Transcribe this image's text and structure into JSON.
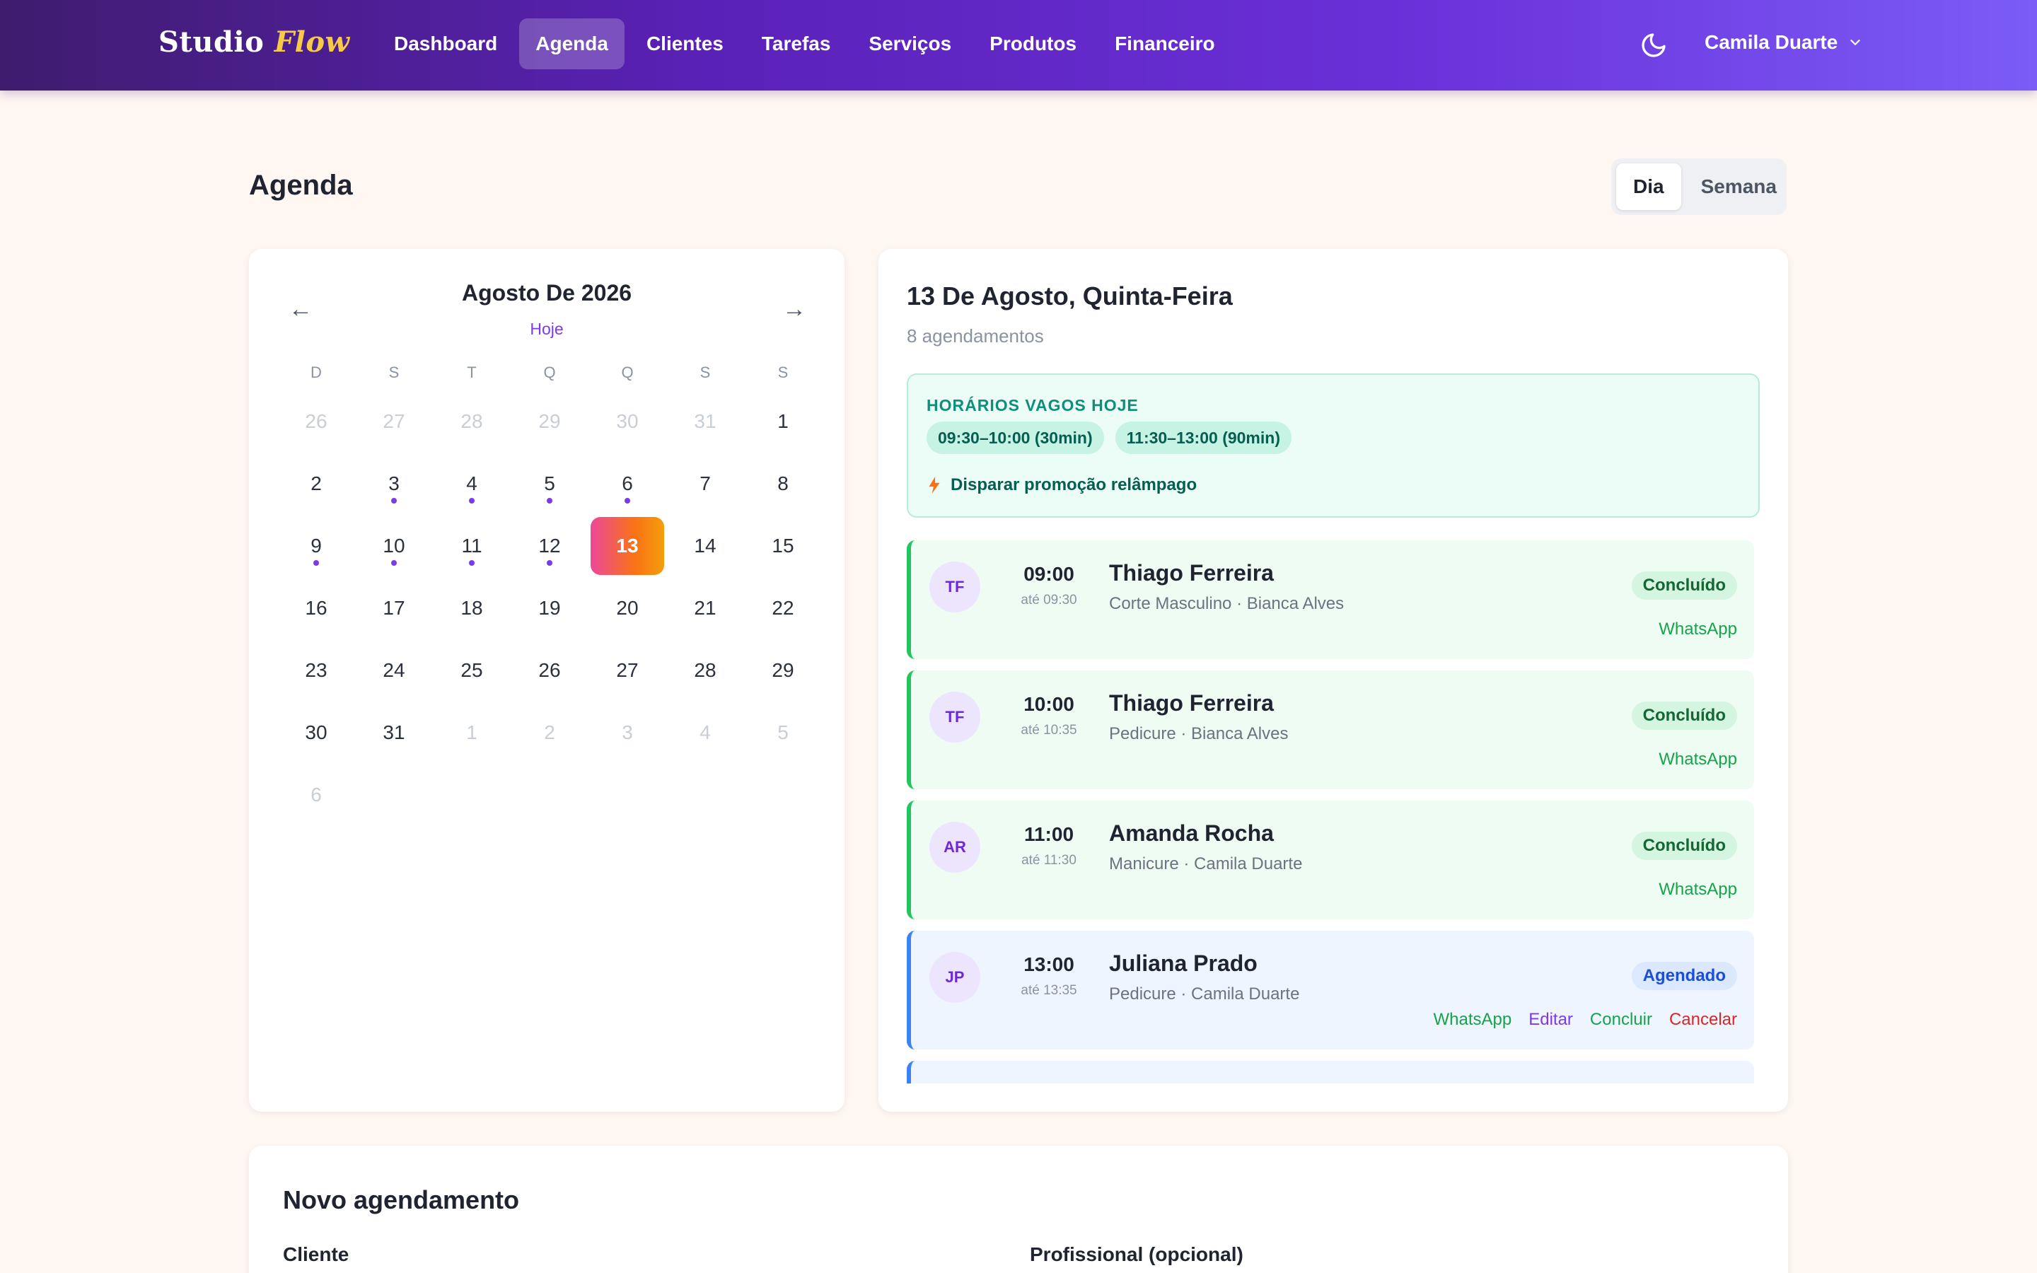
{
  "header": {
    "brand_main": "Studio",
    "brand_accent": "Flow",
    "nav": [
      "Dashboard",
      "Agenda",
      "Clientes",
      "Tarefas",
      "Serviços",
      "Produtos",
      "Financeiro"
    ],
    "active_nav": "Agenda",
    "user_name": "Camila Duarte",
    "theme_icon": "moon-icon"
  },
  "page": {
    "title": "Agenda",
    "view_day": "Dia",
    "view_week": "Semana",
    "active_view": "Dia"
  },
  "calendar": {
    "month_label": "Agosto De 2026",
    "today_label": "Hoje",
    "prev_arrow": "←",
    "next_arrow": "→",
    "weekdays": [
      "D",
      "S",
      "T",
      "Q",
      "Q",
      "S",
      "S"
    ],
    "days": [
      {
        "n": "26",
        "muted": true
      },
      {
        "n": "27",
        "muted": true
      },
      {
        "n": "28",
        "muted": true
      },
      {
        "n": "29",
        "muted": true
      },
      {
        "n": "30",
        "muted": true
      },
      {
        "n": "31",
        "muted": true
      },
      {
        "n": "1"
      },
      {
        "n": "2"
      },
      {
        "n": "3",
        "dot": true
      },
      {
        "n": "4",
        "dot": true
      },
      {
        "n": "5",
        "dot": true
      },
      {
        "n": "6",
        "dot": true
      },
      {
        "n": "7"
      },
      {
        "n": "8"
      },
      {
        "n": "9",
        "dot": true
      },
      {
        "n": "10",
        "dot": true
      },
      {
        "n": "11",
        "dot": true
      },
      {
        "n": "12",
        "dot": true
      },
      {
        "n": "13",
        "selected": true
      },
      {
        "n": "14"
      },
      {
        "n": "15"
      },
      {
        "n": "16"
      },
      {
        "n": "17"
      },
      {
        "n": "18"
      },
      {
        "n": "19"
      },
      {
        "n": "20"
      },
      {
        "n": "21"
      },
      {
        "n": "22"
      },
      {
        "n": "23"
      },
      {
        "n": "24"
      },
      {
        "n": "25"
      },
      {
        "n": "26"
      },
      {
        "n": "27"
      },
      {
        "n": "28"
      },
      {
        "n": "29"
      },
      {
        "n": "30"
      },
      {
        "n": "31"
      },
      {
        "n": "1",
        "muted": true
      },
      {
        "n": "2",
        "muted": true
      },
      {
        "n": "3",
        "muted": true
      },
      {
        "n": "4",
        "muted": true
      },
      {
        "n": "5",
        "muted": true
      },
      {
        "n": "6",
        "muted": true
      }
    ]
  },
  "day_panel": {
    "date_label": "13 De Agosto, Quinta-Feira",
    "count_label": "8 agendamentos",
    "free_title": "HORÁRIOS VAGOS HOJE",
    "free_slots": [
      "09:30–10:00 (30min)",
      "11:30–13:00 (90min)"
    ],
    "promo_label": "Disparar promoção relâmpago",
    "appointments": [
      {
        "initials": "TF",
        "start": "09:00",
        "end": "até 09:30",
        "client": "Thiago Ferreira",
        "service": "Corte Masculino · Bianca Alves",
        "status": "Concluído",
        "state": "done",
        "actions": [
          "WhatsApp"
        ]
      },
      {
        "initials": "TF",
        "start": "10:00",
        "end": "até 10:35",
        "client": "Thiago Ferreira",
        "service": "Pedicure · Bianca Alves",
        "status": "Concluído",
        "state": "done",
        "actions": [
          "WhatsApp"
        ]
      },
      {
        "initials": "AR",
        "start": "11:00",
        "end": "até 11:30",
        "client": "Amanda Rocha",
        "service": "Manicure · Camila Duarte",
        "status": "Concluído",
        "state": "done",
        "actions": [
          "WhatsApp"
        ]
      },
      {
        "initials": "JP",
        "start": "13:00",
        "end": "até 13:35",
        "client": "Juliana Prado",
        "service": "Pedicure · Camila Duarte",
        "status": "Agendado",
        "state": "scheduled",
        "actions": [
          "WhatsApp",
          "Editar",
          "Concluir",
          "Cancelar"
        ]
      },
      {
        "initials": "",
        "start": "",
        "end": "",
        "client": "",
        "service": "",
        "status": "",
        "state": "scheduled",
        "actions": []
      }
    ]
  },
  "new_appointment": {
    "title": "Novo agendamento",
    "client_label": "Cliente",
    "professional_label": "Profissional (opcional)"
  }
}
